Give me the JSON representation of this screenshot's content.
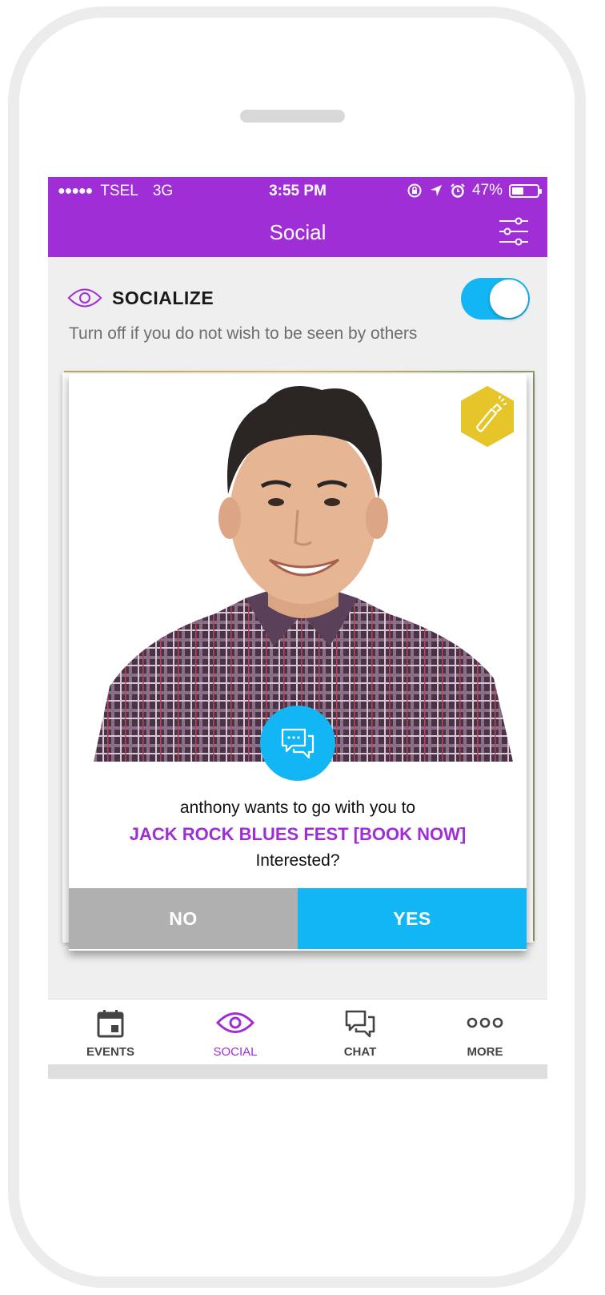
{
  "status_bar": {
    "signal_dots": "●●●●●",
    "carrier": "TSEL",
    "network": "3G",
    "time": "3:55 PM",
    "battery_text": "47%",
    "battery_level": 0.47
  },
  "header": {
    "title": "Social"
  },
  "socialize": {
    "label": "SOCIALIZE",
    "hint": "Turn off if you do not wish to be seen by others",
    "enabled": true
  },
  "card": {
    "line1": "anthony wants to go with you to",
    "event_link": "JACK ROCK BLUES FEST [BOOK NOW]",
    "line3": "Interested?",
    "no_label": "NO",
    "yes_label": "YES"
  },
  "tabs": [
    {
      "label": "EVENTS",
      "icon": "calendar-icon"
    },
    {
      "label": "SOCIAL",
      "icon": "eye-icon",
      "active": true
    },
    {
      "label": "CHAT",
      "icon": "chat-bubbles-icon"
    },
    {
      "label": "MORE",
      "icon": "more-dots-icon"
    }
  ],
  "colors": {
    "brand_purple": "#a02ed6",
    "accent_blue": "#13b6f5",
    "badge_yellow": "#e5c52a",
    "no_gray": "#b0b0b0"
  }
}
